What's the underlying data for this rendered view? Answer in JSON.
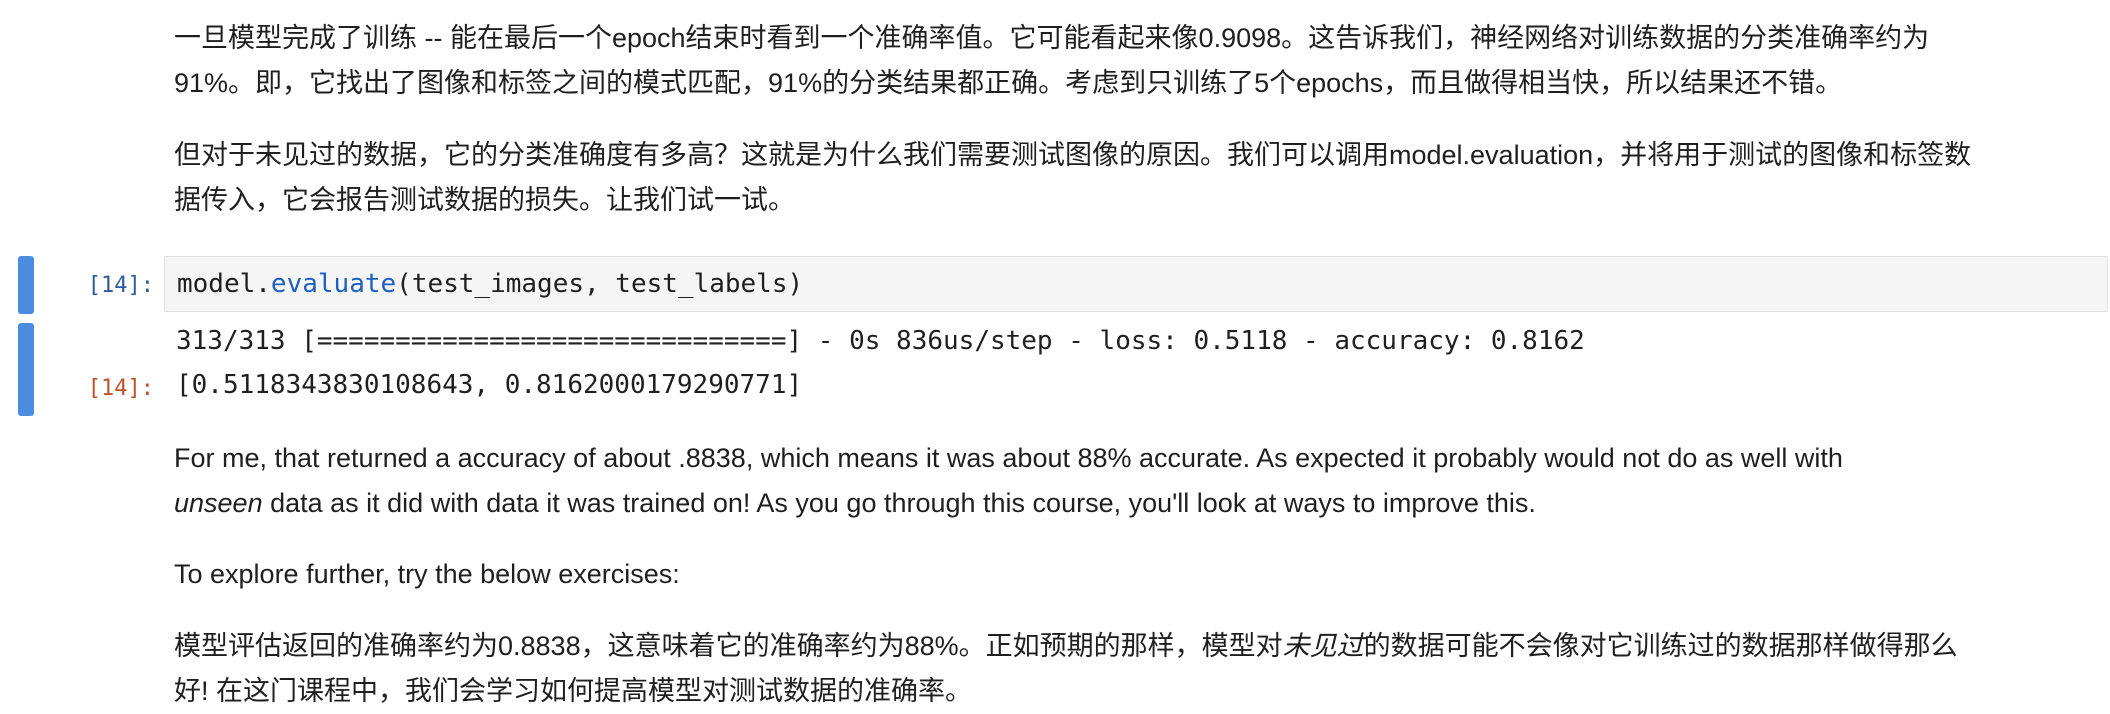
{
  "markdown": {
    "p1_line1": "一旦模型完成了训练 -- 能在最后一个epoch结束时看到一个准确率值。它可能看起来像0.9098。这告诉我们，神经网络对训练数据的分类准确率约为",
    "p1_line2": "91%。即，它找出了图像和标签之间的模式匹配，91%的分类结果都正确。考虑到只训练了5个epochs，而且做得相当快，所以结果还不错。",
    "p2_line1": "但对于未见过的数据，它的分类准确度有多高？这就是为什么我们需要测试图像的原因。我们可以调用model.evaluation，并将用于测试的图像和标签数",
    "p2_line2": "据传入，它会报告测试数据的损失。让我们试一试。",
    "p3_line1": "For me, that returned a accuracy of about .8838, which means it was about 88% accurate. As expected it probably would not do as well with",
    "p3_line2_italic": "unseen",
    "p3_line2_rest": " data as it did with data it was trained on! As you go through this course, you'll look at ways to improve this.",
    "p4": "To explore further, try the below exercises:",
    "p5_line1_a": "模型评估返回的准确率约为0.8838，这意味着它的准确率约为88%。正如预期的那样，模型对",
    "p5_line1_italic": "未见过",
    "p5_line1_b": "的数据可能不会像对它训练过的数据那样做得那么",
    "p5_line2": "好! 在这门课程中，我们会学习如何提高模型对测试数据的准确率。"
  },
  "cell": {
    "input_prompt": "[14]:",
    "output_prompt": "[14]:",
    "code_obj": "model.",
    "code_fn": "evaluate",
    "code_args": "(test_images, test_labels)",
    "stream_output": "313/313 [==============================] - 0s 836us/step - loss: 0.5118 - accuracy: 0.8162",
    "result_output": "[0.5118343830108643, 0.8162000179290771]"
  },
  "colors": {
    "cell_bar": "#4a8de0",
    "input_prompt": "#2c5aa0",
    "output_prompt": "#c2502a",
    "code_function": "#1f5fbf"
  }
}
